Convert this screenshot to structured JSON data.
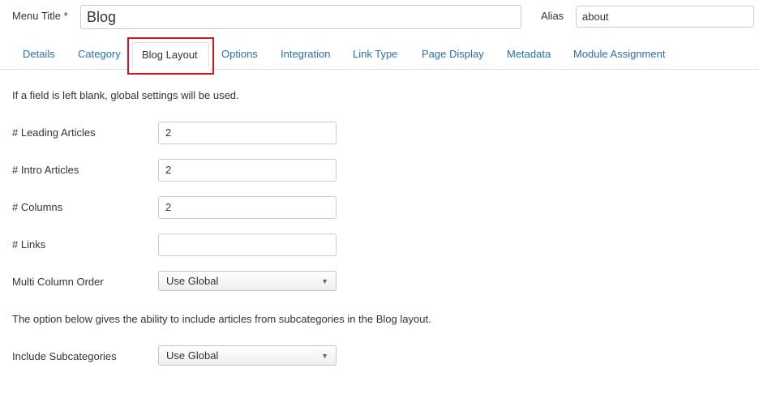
{
  "header": {
    "menu_title_label": "Menu Title *",
    "menu_title_value": "Blog",
    "alias_label": "Alias",
    "alias_value": "about"
  },
  "tabs": [
    {
      "label": "Details"
    },
    {
      "label": "Category"
    },
    {
      "label": "Blog Layout",
      "active": true
    },
    {
      "label": "Options"
    },
    {
      "label": "Integration"
    },
    {
      "label": "Link Type"
    },
    {
      "label": "Page Display"
    },
    {
      "label": "Metadata"
    },
    {
      "label": "Module Assignment"
    }
  ],
  "main": {
    "intro_note": "If a field is left blank, global settings will be used.",
    "fields": {
      "leading_articles": {
        "label": "# Leading Articles",
        "value": "2"
      },
      "intro_articles": {
        "label": "# Intro Articles",
        "value": "2"
      },
      "columns": {
        "label": "# Columns",
        "value": "2"
      },
      "links": {
        "label": "# Links",
        "value": ""
      },
      "multi_column_order": {
        "label": "Multi Column Order",
        "value": "Use Global"
      }
    },
    "subcategories_note": "The option below gives the ability to include articles from subcategories in the Blog layout.",
    "include_subcategories": {
      "label": "Include Subcategories",
      "value": "Use Global"
    }
  },
  "colors": {
    "link": "#2a6fb0",
    "highlight": "#d7141a",
    "border": "#cccccc"
  },
  "icons": {
    "select_arrow": "chevron-down-icon"
  }
}
